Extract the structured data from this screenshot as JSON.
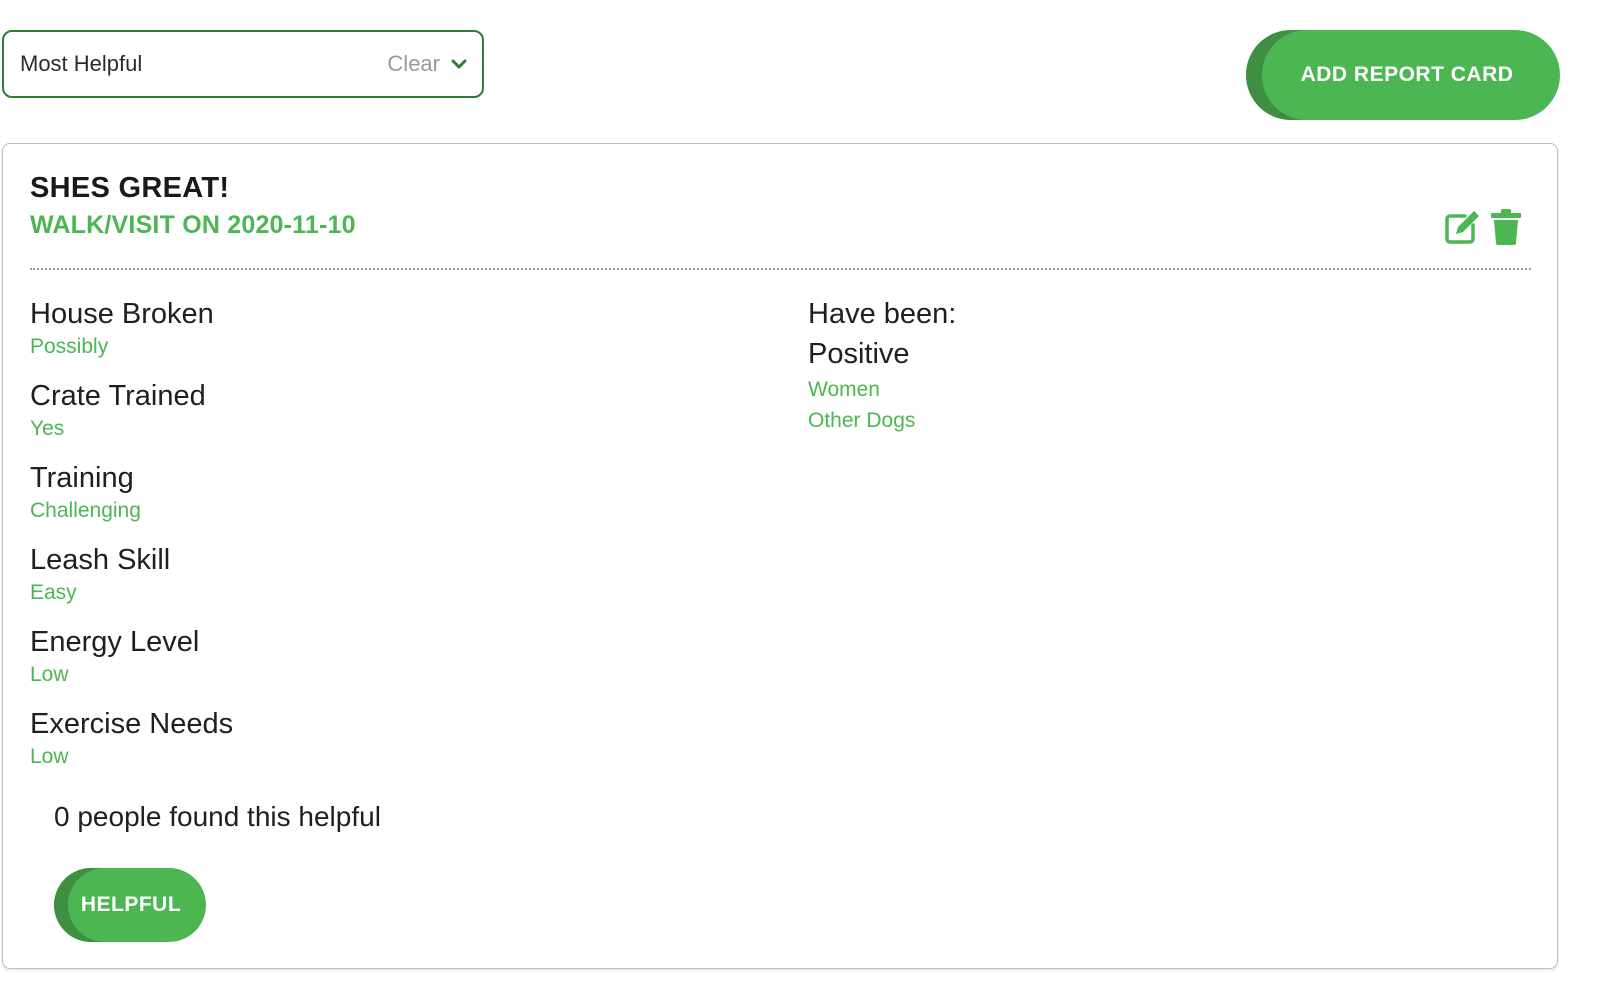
{
  "sort": {
    "selected": "Most Helpful",
    "clear_label": "Clear",
    "icon": "chevron-down-icon"
  },
  "toolbar": {
    "add_report_card_label": "ADD REPORT CARD"
  },
  "card": {
    "title": "SHES GREAT!",
    "subtitle": "WALK/VISIT ON 2020-11-10",
    "actions": {
      "edit_icon": "edit-icon",
      "delete_icon": "trash-icon"
    },
    "attributes": [
      {
        "label": "House Broken",
        "value": "Possibly"
      },
      {
        "label": "Crate Trained",
        "value": "Yes"
      },
      {
        "label": "Training",
        "value": "Challenging"
      },
      {
        "label": "Leash Skill",
        "value": "Easy"
      },
      {
        "label": "Energy Level",
        "value": "Low"
      },
      {
        "label": "Exercise Needs",
        "value": "Low"
      }
    ],
    "experience": {
      "heading": "Have been:",
      "sentiment": "Positive",
      "items": [
        "Women",
        "Other Dogs"
      ]
    },
    "helpful_count_text": "0 people found this helpful",
    "helpful_button_label": "HELPFUL"
  },
  "colors": {
    "accent": "#4cb752",
    "accent_dark": "#3f8f43",
    "border_green": "#2e7d32"
  }
}
